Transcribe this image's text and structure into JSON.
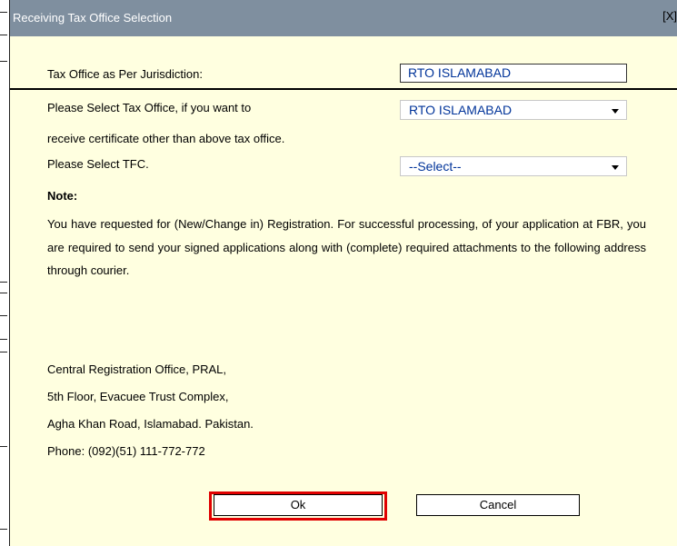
{
  "dialog": {
    "title": "Receiving Tax Office Selection",
    "close_label": "[X]",
    "jurisdiction": {
      "label": "Tax Office as Per Jurisdiction:",
      "value": "RTO ISLAMABAD"
    },
    "tax_office_select": {
      "label_line1": "Please Select Tax Office, if you want to",
      "label_line2": "receive certificate other than above tax office.",
      "selected": "RTO ISLAMABAD"
    },
    "tfc_select": {
      "label": "Please Select TFC.",
      "selected": "--Select--"
    },
    "note": {
      "title": "Note:",
      "text": "You have requested for (New/Change in) Registration. For successful processing, of your application at FBR, you are required to send your signed applications along with (complete) required attachments to the following address through courier."
    },
    "address": {
      "line1": "Central Registration Office, PRAL,",
      "line2": "5th Floor, Evacuee Trust Complex,",
      "line3": "Agha Khan Road, Islamabad. Pakistan.",
      "line4": "Phone: (092)(51) 111-772-772"
    },
    "buttons": {
      "ok_label": "Ok",
      "cancel_label": "Cancel"
    }
  },
  "colors": {
    "dialog_background": "#ffffe0",
    "titlebar": "#7f8f9f",
    "select_text": "#003399",
    "highlight": "#e00000"
  }
}
